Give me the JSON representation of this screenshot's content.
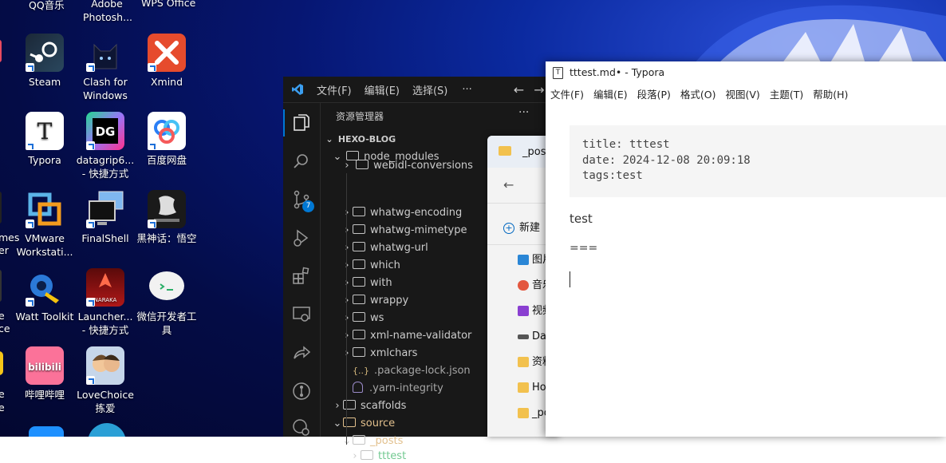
{
  "desktop": {
    "partial_top": [
      "QQ音乐",
      "Adobe Photosh...",
      "WPS Office"
    ],
    "icons": [
      {
        "label": "Steam"
      },
      {
        "label": "Clash for Windows"
      },
      {
        "label": "Xmind"
      },
      {
        "label": "Typora"
      },
      {
        "label": "datagrip6... - 快捷方式"
      },
      {
        "label": "百度网盘"
      },
      {
        "label": "VMware Workstati..."
      },
      {
        "label": "FinalShell"
      },
      {
        "label": "黑神话：悟空"
      },
      {
        "label": "Watt Toolkit"
      },
      {
        "label": "Launcher... - 快捷方式"
      },
      {
        "label": "微信开发者工具"
      },
      {
        "label": "哔哩哔哩"
      },
      {
        "label": "LoveChoice 拣爱"
      }
    ],
    "left_edge_fragments": [
      "mes",
      "er",
      "e",
      "ce",
      "e",
      "e"
    ]
  },
  "vscode": {
    "menu": [
      "文件(F)",
      "编辑(E)",
      "选择(S)",
      "···"
    ],
    "scm_badge": "7",
    "explorer_title": "资源管理器",
    "explorer_more": "···",
    "workspace": "HEXO-BLOG",
    "tree": [
      {
        "label": "node_modules",
        "indent": 1,
        "kind": "folder-open"
      },
      {
        "label": "webidl-conversions",
        "indent": 2,
        "kind": "folder"
      },
      {
        "label": "whatwg-encoding",
        "indent": 2,
        "kind": "folder"
      },
      {
        "label": "whatwg-mimetype",
        "indent": 2,
        "kind": "folder"
      },
      {
        "label": "whatwg-url",
        "indent": 2,
        "kind": "folder"
      },
      {
        "label": "which",
        "indent": 2,
        "kind": "folder"
      },
      {
        "label": "with",
        "indent": 2,
        "kind": "folder"
      },
      {
        "label": "wrappy",
        "indent": 2,
        "kind": "folder"
      },
      {
        "label": "ws",
        "indent": 2,
        "kind": "folder"
      },
      {
        "label": "xml-name-validator",
        "indent": 2,
        "kind": "folder"
      },
      {
        "label": "xmlchars",
        "indent": 2,
        "kind": "folder"
      },
      {
        "label": ".package-lock.json",
        "indent": 2,
        "kind": "json"
      },
      {
        "label": ".yarn-integrity",
        "indent": 2,
        "kind": "file"
      },
      {
        "label": "scaffolds",
        "indent": 1,
        "kind": "folder"
      },
      {
        "label": "source",
        "indent": 1,
        "kind": "folder-open"
      },
      {
        "label": "_posts",
        "indent": 2,
        "kind": "folder-open"
      },
      {
        "label": "tttest",
        "indent": 3,
        "kind": "folder"
      }
    ],
    "colors": {
      "json": "#d7ba7d",
      "yarn": "#9b8bc9",
      "source": "#e2c08d",
      "green": "#73c991"
    }
  },
  "explorer": {
    "tab_label": "_post",
    "new_label": "新建",
    "items": [
      "图片",
      "音乐",
      "视频",
      "Da",
      "资料",
      "Ho",
      "_po"
    ]
  },
  "typora": {
    "title": "tttest.md• - Typora",
    "menu": [
      "文件(F)",
      "编辑(E)",
      "段落(P)",
      "格式(O)",
      "视图(V)",
      "主题(T)",
      "帮助(H)"
    ],
    "front_matter": [
      "title: tttest",
      "date: 2024-12-08 20:09:18",
      "tags:test"
    ],
    "paragraph": "test",
    "line2": "==="
  }
}
